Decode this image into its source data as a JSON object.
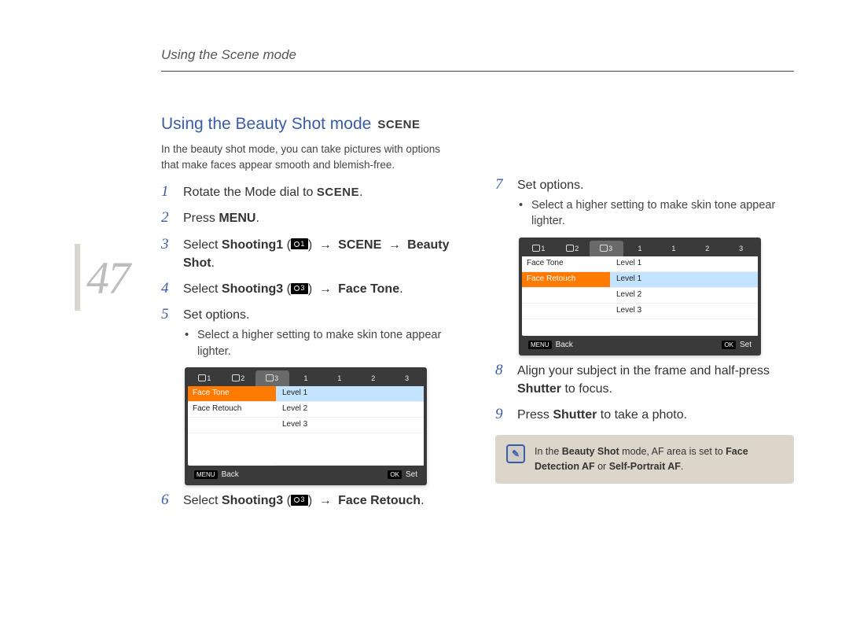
{
  "page_number": "47",
  "header": "Using the Scene mode",
  "section_title": "Using the Beauty Shot mode",
  "section_badge": "SCENE",
  "intro": "In the beauty shot mode, you can take pictures with options that make faces appear smooth and blemish-free.",
  "steps": {
    "s1": {
      "num": "1",
      "pre": "Rotate the Mode dial to ",
      "badge": "SCENE",
      "post": "."
    },
    "s2": {
      "num": "2",
      "pre": "Press ",
      "b1": "MENU",
      "post1": "."
    },
    "s3": {
      "num": "3",
      "pre": "Select ",
      "b1": "Shooting1",
      "mid1": " (",
      "icon_sub": "1",
      "mid2": ") ",
      "arr": "→",
      "b2": " SCENE ",
      "arr2": "→",
      "b3": "Beauty Shot",
      "post": "."
    },
    "s4": {
      "num": "4",
      "pre": "Select ",
      "b1": "Shooting3",
      "mid1": " (",
      "icon_sub": "3",
      "mid2": ") ",
      "arr": "→",
      "b2": " Face Tone",
      "post": "."
    },
    "s5": {
      "num": "5",
      "text": "Set options."
    },
    "s5_bullet": "Select a higher setting to make skin tone appear lighter.",
    "s6": {
      "num": "6",
      "pre": "Select ",
      "b1": "Shooting3",
      "mid1": " (",
      "icon_sub": "3",
      "mid2": ") ",
      "arr": "→",
      "b2": " Face Retouch",
      "post": "."
    },
    "s7": {
      "num": "7",
      "text": "Set options."
    },
    "s7_bullet": "Select a higher setting to make skin tone appear lighter.",
    "s8": {
      "num": "8",
      "text_pre": "Align your subject in the frame and half-press ",
      "b1": "Shutter",
      "text_post": " to focus."
    },
    "s9": {
      "num": "9",
      "text_pre": "Press ",
      "b1": "Shutter",
      "text_post": " to take a photo."
    }
  },
  "menu1": {
    "tabs": [
      "1",
      "2",
      "3",
      "1",
      "1",
      "2",
      "3"
    ],
    "rows": [
      {
        "label": "Face Tone",
        "highlight": true,
        "value": "Level 1",
        "selected": true
      },
      {
        "label": "Face Retouch",
        "highlight": false,
        "value": "Level 2",
        "selected": false
      },
      {
        "label": "",
        "highlight": false,
        "value": "Level 3",
        "selected": false
      }
    ],
    "footer": {
      "back_key": "MENU",
      "back_label": "Back",
      "set_key": "OK",
      "set_label": "Set"
    }
  },
  "menu2": {
    "tabs": [
      "1",
      "2",
      "3",
      "1",
      "1",
      "2",
      "3"
    ],
    "rows": [
      {
        "label": "Face Tone",
        "highlight": false,
        "value": "Level 1",
        "selected": false
      },
      {
        "label": "Face Retouch",
        "highlight": true,
        "value": "Level 1",
        "selected": true
      },
      {
        "label": "",
        "highlight": false,
        "value": "Level 2",
        "selected": false
      },
      {
        "label": "",
        "highlight": false,
        "value": "Level 3",
        "selected": false
      }
    ],
    "footer": {
      "back_key": "MENU",
      "back_label": "Back",
      "set_key": "OK",
      "set_label": "Set"
    }
  },
  "note": {
    "pre": "In the ",
    "b1": "Beauty Shot",
    "mid": " mode, AF area is set to ",
    "b2": "Face Detection AF",
    "mid2": " or ",
    "b3": "Self-Portrait AF",
    "post": "."
  }
}
